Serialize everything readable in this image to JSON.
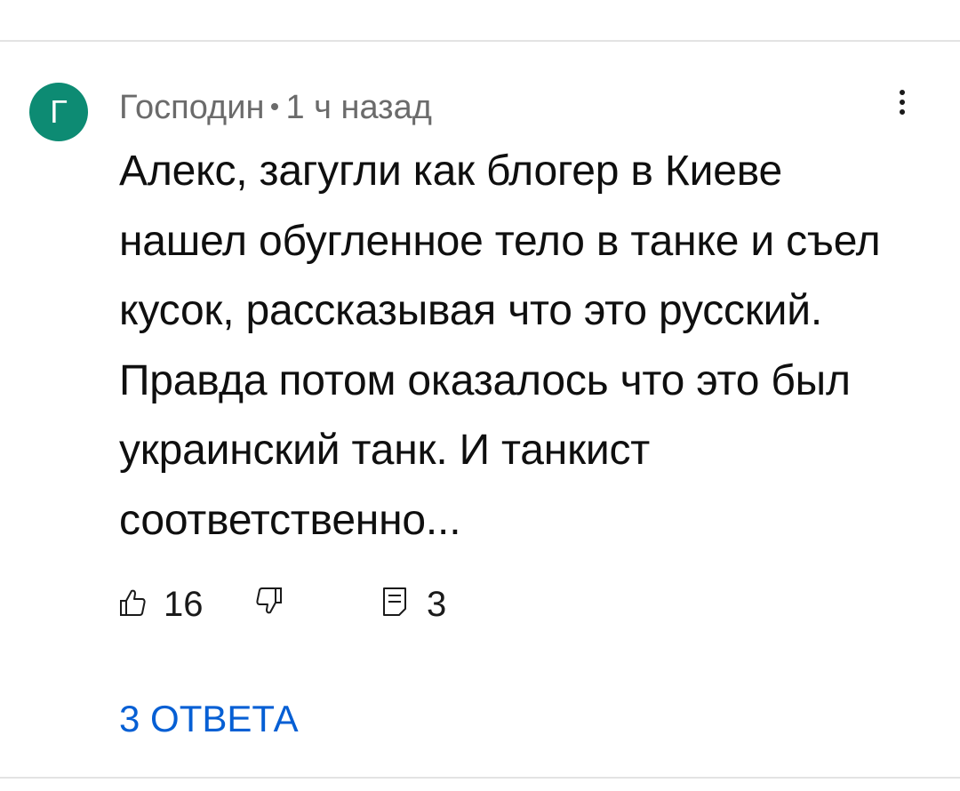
{
  "comment": {
    "avatar_letter": "Г",
    "avatar_color": "#0d8b73",
    "author": "Господин",
    "separator": "•",
    "time": "1 ч назад",
    "more_icon": "vertical-ellipsis-icon",
    "text": "Алекс, загугли как блогер в Киеве нашел обугленное тело в танке и съел кусок, рассказывая что это русский. Правда потом оказалось что это был украинский танк. И танкист соответственно...",
    "actions": {
      "like_icon": "thumbs-up-icon",
      "like_count": "16",
      "dislike_icon": "thumbs-down-icon",
      "reply_icon": "reply-comment-icon",
      "reply_count": "3"
    },
    "replies_label": "3 ОТВЕТА",
    "link_color": "#065fd4"
  }
}
